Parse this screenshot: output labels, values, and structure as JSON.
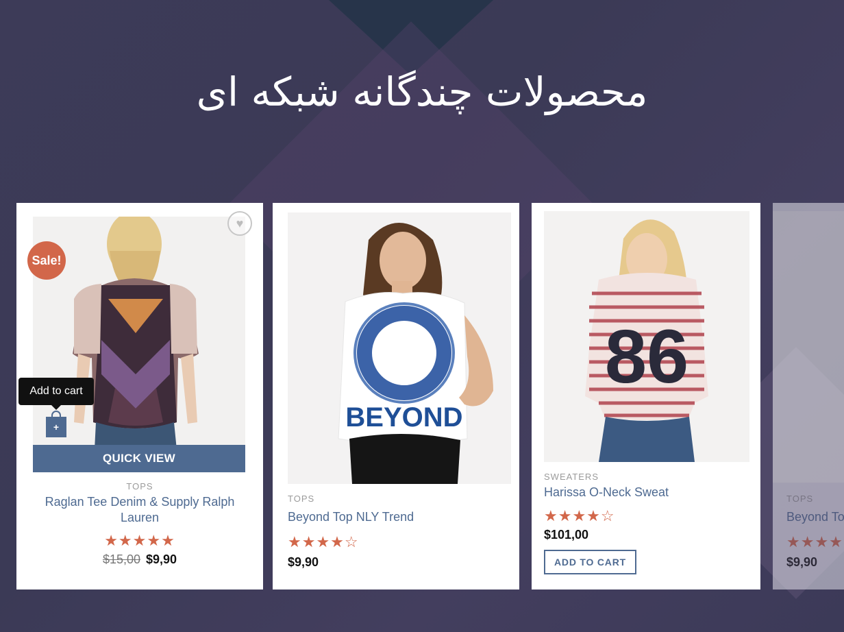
{
  "page": {
    "title": "محصولات چندگانه شبکه ای"
  },
  "products": [
    {
      "badge": "Sale!",
      "tooltip": "Add to cart",
      "add_icon": "+",
      "quick_view": "QUICK VIEW",
      "category": "TOPS",
      "name": "Raglan Tee Denim & Supply Ralph Lauren",
      "rating": 5,
      "stars": "★★★★★",
      "old_price": "$15,00",
      "price": "$9,90"
    },
    {
      "category": "TOPS",
      "name": "Beyond Top NLY Trend",
      "rating": 4,
      "stars": "★★★★☆",
      "price": "$9,90",
      "shirt_text": "BEYOND"
    },
    {
      "category": "SWEATERS",
      "name": "Harissa O-Neck Sweat",
      "rating": 4.5,
      "stars": "★★★★☆",
      "price": "$101,00",
      "button": "ADD TO CART",
      "shirt_text": "86"
    },
    {
      "category": "TOPS",
      "name": "Beyond To",
      "stars": "★★★★★",
      "price": "$9,90"
    }
  ],
  "colors": {
    "accent": "#4e6a91",
    "sale": "#d2674a",
    "stars": "#d2674a"
  },
  "icons": [
    "heart-icon",
    "shopping-bag-icon",
    "star-icon"
  ]
}
